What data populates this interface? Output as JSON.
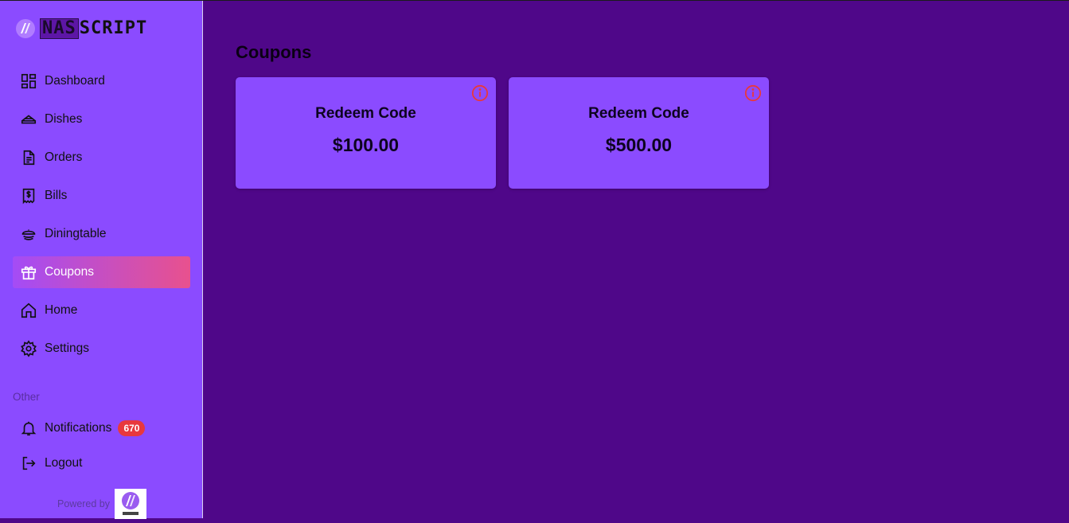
{
  "brand": {
    "part1": "NAS",
    "part2": "SCRIPT"
  },
  "sidebar": {
    "items": [
      {
        "label": "Dashboard",
        "icon": "dashboard-icon"
      },
      {
        "label": "Dishes",
        "icon": "dish-icon"
      },
      {
        "label": "Orders",
        "icon": "document-icon"
      },
      {
        "label": "Bills",
        "icon": "receipt-icon"
      },
      {
        "label": "Diningtable",
        "icon": "table-icon"
      },
      {
        "label": "Coupons",
        "icon": "gift-icon",
        "active": true
      },
      {
        "label": "Home",
        "icon": "home-icon"
      },
      {
        "label": "Settings",
        "icon": "gear-icon"
      }
    ],
    "other_label": "Other",
    "notifications": {
      "label": "Notifications",
      "count": "670",
      "icon": "bell-icon"
    },
    "logout": {
      "label": "Logout",
      "icon": "logout-icon"
    },
    "powered_by": "Powered by"
  },
  "main": {
    "title": "Coupons",
    "coupons": [
      {
        "label": "Redeem Code",
        "amount": "$100.00"
      },
      {
        "label": "Redeem Code",
        "amount": "$500.00"
      }
    ]
  },
  "colors": {
    "sidebar_bg": "#8b4bff",
    "main_bg": "#4f0789",
    "active_gradient_start": "#a44cf6",
    "active_gradient_end": "#e8518e",
    "badge": "#e8383d",
    "info_icon": "#e8383d"
  }
}
